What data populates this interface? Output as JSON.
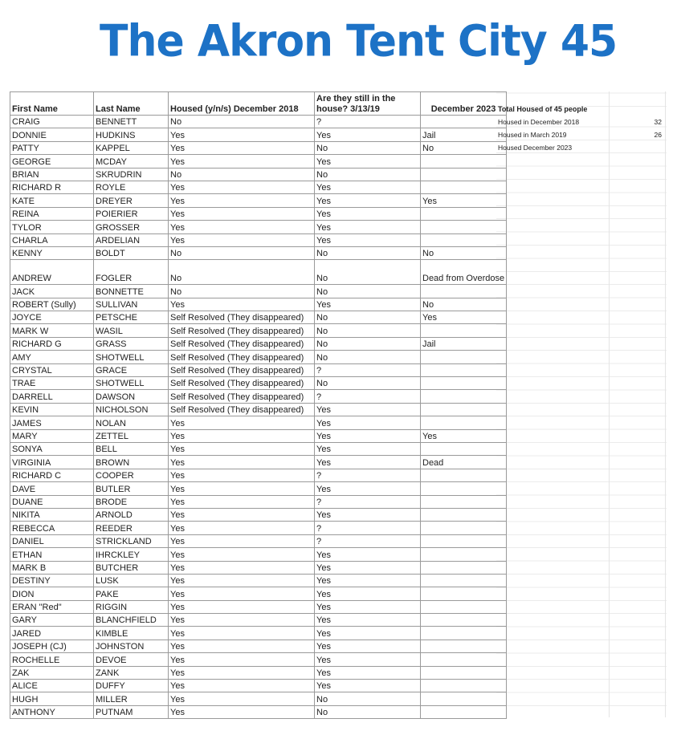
{
  "title": "The Akron Tent City 45",
  "table": {
    "headers": [
      "First Name",
      "Last Name",
      "Housed (y/n/s) December 2018",
      "Are they still in the house? 3/13/19",
      "December 2023"
    ],
    "rows": [
      [
        "CRAIG",
        "BENNETT",
        "No",
        "?",
        ""
      ],
      [
        "DONNIE",
        "HUDKINS",
        "Yes",
        "Yes",
        "Jail"
      ],
      [
        "PATTY",
        "KAPPEL",
        "Yes",
        "No",
        "No"
      ],
      [
        "GEORGE",
        "MCDAY",
        "Yes",
        "Yes",
        ""
      ],
      [
        "BRIAN",
        "SKRUDRIN",
        "No",
        "No",
        ""
      ],
      [
        "RICHARD R",
        "ROYLE",
        "Yes",
        "Yes",
        ""
      ],
      [
        "KATE",
        "DREYER",
        "Yes",
        "Yes",
        "Yes"
      ],
      [
        "REINA",
        "POIERIER",
        "Yes",
        "Yes",
        ""
      ],
      [
        "TYLOR",
        "GROSSER",
        "Yes",
        "Yes",
        ""
      ],
      [
        "CHARLA",
        "ARDELIAN",
        "Yes",
        "Yes",
        ""
      ],
      [
        "KENNY",
        "BOLDT",
        "No",
        "No",
        "No"
      ],
      [
        "ANDREW",
        "FOGLER",
        "No",
        "No",
        "Dead from Overdose"
      ],
      [
        "JACK",
        "BONNETTE",
        "No",
        "No",
        ""
      ],
      [
        "ROBERT (Sully)",
        "SULLIVAN",
        "Yes",
        "Yes",
        "No"
      ],
      [
        "JOYCE",
        "PETSCHE",
        "Self Resolved (They disappeared)",
        "No",
        "Yes"
      ],
      [
        "MARK W",
        "WASIL",
        "Self Resolved (They disappeared)",
        "No",
        ""
      ],
      [
        "RICHARD G",
        "GRASS",
        "Self Resolved (They disappeared)",
        "No",
        "Jail"
      ],
      [
        "AMY",
        "SHOTWELL",
        "Self Resolved (They disappeared)",
        "No",
        ""
      ],
      [
        "CRYSTAL",
        "GRACE",
        "Self Resolved (They disappeared)",
        "?",
        ""
      ],
      [
        "TRAE",
        "SHOTWELL",
        "Self Resolved (They disappeared)",
        "No",
        ""
      ],
      [
        "DARRELL",
        "DAWSON",
        "Self Resolved (They disappeared)",
        "?",
        ""
      ],
      [
        "KEVIN",
        "NICHOLSON",
        "Self Resolved (They disappeared)",
        "Yes",
        ""
      ],
      [
        "JAMES",
        "NOLAN",
        "Yes",
        "Yes",
        ""
      ],
      [
        "MARY",
        "ZETTEL",
        "Yes",
        "Yes",
        "Yes"
      ],
      [
        "SONYA",
        "BELL",
        "Yes",
        "Yes",
        ""
      ],
      [
        "VIRGINIA",
        "BROWN",
        "Yes",
        "Yes",
        "Dead"
      ],
      [
        "RICHARD C",
        "COOPER",
        "Yes",
        "?",
        ""
      ],
      [
        "DAVE",
        "BUTLER",
        "Yes",
        "Yes",
        ""
      ],
      [
        "DUANE",
        "BRODE",
        "Yes",
        "?",
        ""
      ],
      [
        "NIKITA",
        "ARNOLD",
        "Yes",
        "Yes",
        ""
      ],
      [
        "REBECCA",
        "REEDER",
        "Yes",
        "?",
        ""
      ],
      [
        "DANIEL",
        "STRICKLAND",
        "Yes",
        "?",
        ""
      ],
      [
        "ETHAN",
        "IHRCKLEY",
        "Yes",
        "Yes",
        ""
      ],
      [
        "MARK B",
        "BUTCHER",
        "Yes",
        "Yes",
        ""
      ],
      [
        "DESTINY",
        "LUSK",
        "Yes",
        "Yes",
        ""
      ],
      [
        "DION",
        "PAKE",
        "Yes",
        "Yes",
        ""
      ],
      [
        "ERAN \"Red\"",
        "RIGGIN",
        "Yes",
        "Yes",
        ""
      ],
      [
        "GARY",
        "BLANCHFIELD",
        "Yes",
        "Yes",
        ""
      ],
      [
        "JARED",
        "KIMBLE",
        "Yes",
        "Yes",
        ""
      ],
      [
        "JOSEPH (CJ)",
        "JOHNSTON",
        "Yes",
        "Yes",
        ""
      ],
      [
        "ROCHELLE",
        "DEVOE",
        "Yes",
        "Yes",
        ""
      ],
      [
        "ZAK",
        "ZANK",
        "Yes",
        "Yes",
        ""
      ],
      [
        "ALICE",
        "DUFFY",
        "Yes",
        "Yes",
        ""
      ],
      [
        "HUGH",
        "MILLER",
        "Yes",
        "No",
        ""
      ],
      [
        "ANTHONY",
        "PUTNAM",
        "Yes",
        "No",
        ""
      ]
    ]
  },
  "summary": {
    "title": "Total Housed of 45 people",
    "rows": [
      {
        "label": "Housed in December 2018",
        "value": "32"
      },
      {
        "label": "Housed  in March 2019",
        "value": "26"
      },
      {
        "label": "Housed December 2023",
        "value": ""
      }
    ]
  },
  "colors": {
    "title": "#1d72c6",
    "grid": "#9a9a9a"
  }
}
